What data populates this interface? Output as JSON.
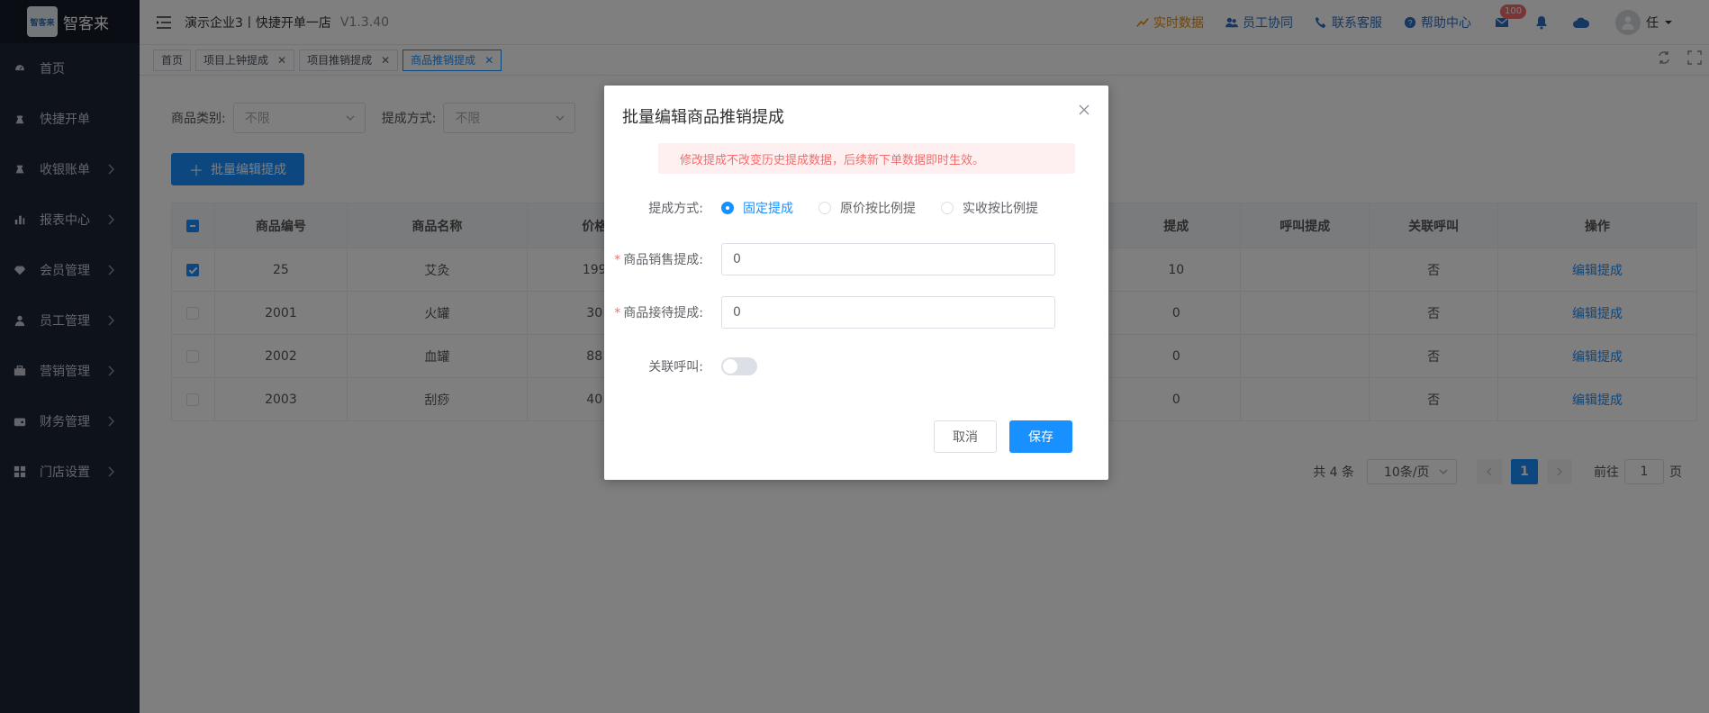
{
  "app": {
    "logo_text": "智客来",
    "logo_mark": "智客来",
    "title": "演示企业3丨快捷开单一店",
    "version": "V1.3.40"
  },
  "header": {
    "realtime_label": "实时数据",
    "staff_label": "员工协同",
    "service_label": "联系客服",
    "help_label": "帮助中心",
    "mail_badge": "100",
    "user_name": "任"
  },
  "sidebar": {
    "items": [
      {
        "label": "首页",
        "icon": "dashboard-icon",
        "has_arrow": false
      },
      {
        "label": "快捷开单",
        "icon": "bag-icon",
        "has_arrow": false
      },
      {
        "label": "收银账单",
        "icon": "money-bag-icon",
        "has_arrow": true
      },
      {
        "label": "报表中心",
        "icon": "bar-chart-icon",
        "has_arrow": true
      },
      {
        "label": "会员管理",
        "icon": "diamond-icon",
        "has_arrow": true
      },
      {
        "label": "员工管理",
        "icon": "person-icon",
        "has_arrow": true
      },
      {
        "label": "营销管理",
        "icon": "briefcase-icon",
        "has_arrow": true
      },
      {
        "label": "财务管理",
        "icon": "wallet-icon",
        "has_arrow": true
      },
      {
        "label": "门店设置",
        "icon": "grid-icon",
        "has_arrow": true
      }
    ]
  },
  "tabs": [
    {
      "label": "首页",
      "closable": false,
      "active": false
    },
    {
      "label": "项目上钟提成",
      "closable": true,
      "active": false
    },
    {
      "label": "项目推销提成",
      "closable": true,
      "active": false
    },
    {
      "label": "商品推销提成",
      "closable": true,
      "active": true
    }
  ],
  "filters": {
    "category_label": "商品类别:",
    "category_value": "不限",
    "method_label": "提成方式:",
    "method_value": "不限"
  },
  "batch_button": "批量编辑提成",
  "table": {
    "headers": [
      "商品编号",
      "商品名称",
      "价格",
      "提成",
      "呼叫提成",
      "关联呼叫",
      "操作"
    ],
    "rows": [
      {
        "code": "25",
        "name": "艾灸",
        "price": "199",
        "commission": "10",
        "linked": "否",
        "action": "编辑提成",
        "checked": true
      },
      {
        "code": "2001",
        "name": "火罐",
        "price": "30",
        "commission": "0",
        "linked": "否",
        "action": "编辑提成",
        "checked": false
      },
      {
        "code": "2002",
        "name": "血罐",
        "price": "88",
        "commission": "0",
        "linked": "否",
        "action": "编辑提成",
        "checked": false
      },
      {
        "code": "2003",
        "name": "刮痧",
        "price": "40",
        "commission": "0",
        "linked": "否",
        "action": "编辑提成",
        "checked": false
      }
    ]
  },
  "pager": {
    "total": "共 4 条",
    "page_size": "10条/页",
    "current": "1",
    "goto_label": "前往",
    "goto_value": "1",
    "page_suffix": "页"
  },
  "modal": {
    "title": "批量编辑商品推销提成",
    "notice": "修改提成不改变历史提成数据，后续新下单数据即时生效。",
    "method_label": "提成方式:",
    "options": [
      "固定提成",
      "原价按比例提",
      "实收按比例提"
    ],
    "selected_option": "固定提成",
    "sale_label": "商品销售提成:",
    "sale_value": "0",
    "reception_label": "商品接待提成:",
    "reception_value": "0",
    "linked_label": "关联呼叫:",
    "linked_on": false,
    "cancel_label": "取消",
    "save_label": "保存"
  },
  "colors": {
    "primary": "#1890ff",
    "sidebar_bg": "#1c2434",
    "danger": "#f56c6c",
    "warning": "#e38b0e"
  }
}
